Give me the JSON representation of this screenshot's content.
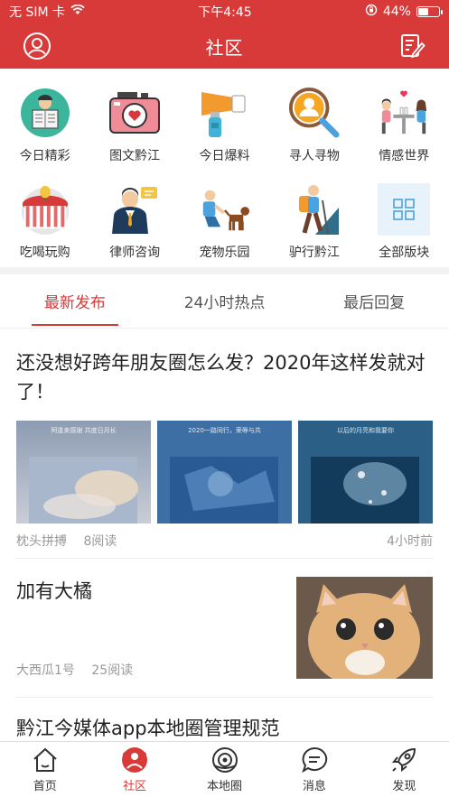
{
  "status": {
    "carrier": "无 SIM 卡",
    "time": "下午4:45",
    "battery": "44%",
    "battery_level": 0.44
  },
  "header": {
    "title": "社区"
  },
  "categories": [
    {
      "label": "今日精彩",
      "icon": "reader-icon"
    },
    {
      "label": "图文黔江",
      "icon": "camera-icon"
    },
    {
      "label": "今日爆料",
      "icon": "megaphone-icon"
    },
    {
      "label": "寻人寻物",
      "icon": "search-person-icon"
    },
    {
      "label": "情感世界",
      "icon": "couple-icon"
    },
    {
      "label": "吃喝玩购",
      "icon": "shop-icon"
    },
    {
      "label": "律师咨询",
      "icon": "lawyer-icon"
    },
    {
      "label": "宠物乐园",
      "icon": "pet-icon"
    },
    {
      "label": "驴行黔江",
      "icon": "hiker-icon"
    },
    {
      "label": "全部版块",
      "icon": "grid-icon"
    }
  ],
  "tabs": [
    "最新发布",
    "24小时热点",
    "最后回复"
  ],
  "posts": [
    {
      "title": "还没想好跨年朋友圈怎么发？2020年这样发就对了！",
      "captions": [
        "阿逢来感谢\n共度日月长",
        "2020一路同行，荣辱与共",
        "以后的月亮和我要你"
      ],
      "author": "枕头拼搏",
      "reads": "8阅读",
      "time": "4小时前"
    },
    {
      "title": "加有大橘",
      "author": "大西瓜1号",
      "reads": "25阅读"
    },
    {
      "title": "黔江今媒体app本地圈管理规范"
    }
  ],
  "nav": [
    {
      "label": "首页",
      "icon": "home-icon"
    },
    {
      "label": "社区",
      "icon": "community-icon"
    },
    {
      "label": "本地圈",
      "icon": "local-circle-icon"
    },
    {
      "label": "消息",
      "icon": "message-icon"
    },
    {
      "label": "发现",
      "icon": "rocket-icon"
    }
  ],
  "colors": {
    "brand": "#d83a3a",
    "divider": "#f2f2f2",
    "meta": "#999999"
  }
}
